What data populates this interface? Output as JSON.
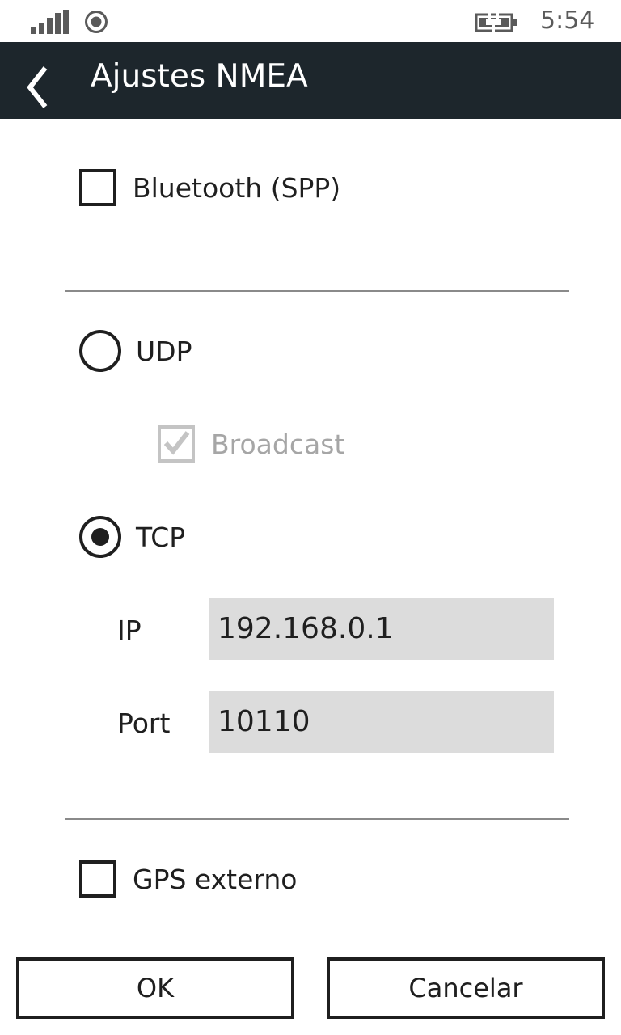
{
  "status_bar": {
    "time": "5:54",
    "icons": [
      "signal-icon",
      "location-icon",
      "battery-charging-icon"
    ]
  },
  "header": {
    "title": "Ajustes NMEA",
    "back_icon": "back-chevron-icon"
  },
  "bluetooth": {
    "label": "Bluetooth (SPP)",
    "checked": false
  },
  "connection": {
    "udp": {
      "label": "UDP",
      "selected": false
    },
    "broadcast": {
      "label": "Broadcast",
      "checked": true,
      "enabled": false
    },
    "tcp": {
      "label": "TCP",
      "selected": true
    },
    "ip": {
      "label": "IP",
      "value": "192.168.0.1"
    },
    "port": {
      "label": "Port",
      "value": "10110"
    }
  },
  "gps_externo": {
    "label": "GPS externo",
    "checked": false
  },
  "buttons": {
    "ok_label": "OK",
    "cancel_label": "Cancelar"
  },
  "colors": {
    "header_bg": "#1d262c",
    "field_bg": "#dcdcdc",
    "disabled": "#a6a6a6"
  }
}
